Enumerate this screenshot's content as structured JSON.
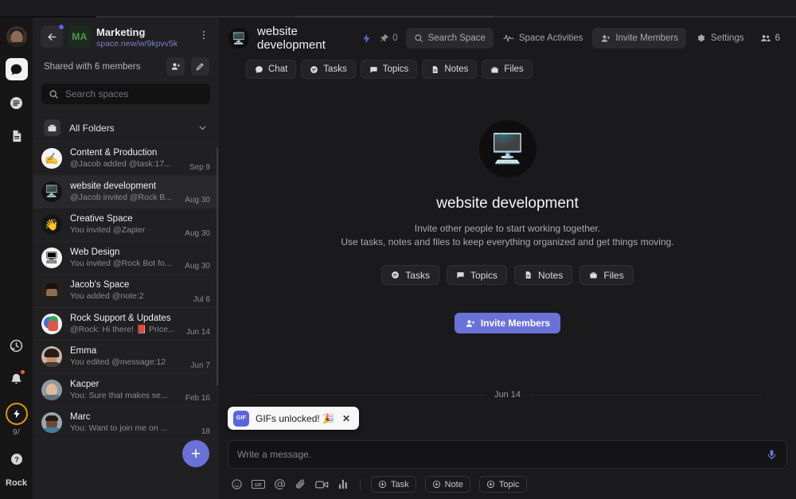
{
  "rail": {
    "avatar_name": "user-avatar",
    "items": [
      {
        "name": "chat",
        "icon": "chat-icon",
        "active": true
      },
      {
        "name": "tasks",
        "icon": "tasks-icon",
        "active": false
      },
      {
        "name": "notes",
        "icon": "notes-icon",
        "active": false
      }
    ],
    "history_icon": "history-clock-icon",
    "notifications_icon": "bell-icon",
    "quick_action_icon": "lightning-bolt-icon",
    "counter": "9/",
    "help_icon": "help-icon",
    "brand": "Rock",
    "accent_orange": "#e8930c"
  },
  "sidebar": {
    "workspace": {
      "badge": "MA",
      "title": "Marketing",
      "url": "space.new/w/9kpvv5k",
      "back_icon": "back-arrow-icon",
      "menu_icon": "kebab-menu-icon"
    },
    "shared_label": "Shared with 6 members",
    "add_member_icon": "add-member-icon",
    "edit_icon": "pencil-edit-icon",
    "search": {
      "placeholder": "Search spaces",
      "value": "",
      "icon": "search-icon"
    },
    "folders": {
      "label": "All Folders",
      "icon": "folder-icon",
      "chevron": "chevron-down-icon"
    },
    "spaces": [
      {
        "name": "Content & Production",
        "preview": "@Jacob added @task:17...",
        "date": "Sep 9",
        "avatar": "writing-hand",
        "selected": false
      },
      {
        "name": "website development",
        "preview": "@Jacob invited @Rock B...",
        "date": "Aug 30",
        "avatar": "desktop",
        "selected": true
      },
      {
        "name": "Creative Space",
        "preview": "You invited @Zapier",
        "date": "Aug 30",
        "avatar": "wave",
        "selected": false
      },
      {
        "name": "Web Design",
        "preview": "You invited @Rock Bot fo...",
        "date": "Aug 30",
        "avatar": "monitor",
        "selected": false
      },
      {
        "name": "Jacob's Space",
        "preview": "You added @note:2",
        "date": "Jul 6",
        "avatar": "person-jacob",
        "selected": false
      },
      {
        "name": "Rock Support & Updates",
        "preview": "@Rock: Hi there! 📕 Price...",
        "date": "Jun 14",
        "avatar": "rock-logo",
        "selected": false
      },
      {
        "name": "Emma",
        "preview": "You edited @message:12",
        "date": "Jun 7",
        "avatar": "person-emma",
        "selected": false
      },
      {
        "name": "Kacper",
        "preview": "You: Sure that makes se...",
        "date": "Feb 16",
        "avatar": "person-kacper",
        "selected": false
      },
      {
        "name": "Marc",
        "preview": "You: Want to join me on ...",
        "date": "18",
        "avatar": "person-marc",
        "selected": false
      }
    ],
    "new_space_label": "+"
  },
  "header": {
    "space_icon": "desktop-icon",
    "title": "website development",
    "bolt_icon": "lightning-bolt-icon",
    "pin_icon": "pin-icon",
    "pin_count": "0",
    "search_space": {
      "label": "Search Space",
      "icon": "search-icon"
    },
    "space_activities": {
      "label": "Space Activities",
      "icon": "activity-icon"
    },
    "invite_members": {
      "label": "Invite Members",
      "icon": "add-member-icon"
    },
    "settings": {
      "label": "Settings",
      "icon": "gear-icon"
    },
    "members_icon": "members-icon",
    "members_count": "6",
    "tabs": [
      {
        "label": "Chat",
        "icon": "chat-bubble-icon"
      },
      {
        "label": "Tasks",
        "icon": "tasks-icon"
      },
      {
        "label": "Topics",
        "icon": "topic-icon"
      },
      {
        "label": "Notes",
        "icon": "note-icon"
      },
      {
        "label": "Files",
        "icon": "folder-icon"
      }
    ]
  },
  "empty_state": {
    "icon": "desktop-icon",
    "title": "website development",
    "line1": "Invite other people to start working together.",
    "line2": "Use tasks, notes and files to keep everything organized and get things moving.",
    "chips": [
      {
        "label": "Tasks",
        "icon": "tasks-icon"
      },
      {
        "label": "Topics",
        "icon": "topic-icon"
      },
      {
        "label": "Notes",
        "icon": "note-icon"
      },
      {
        "label": "Files",
        "icon": "folder-icon"
      }
    ],
    "invite_button": {
      "label": "Invite Members",
      "icon": "add-member-icon",
      "color": "#6a72d8"
    }
  },
  "conversation": {
    "date_divider": "Jun 14"
  },
  "toast": {
    "icon_label": "GIF",
    "text": "GIFs unlocked! 🎉",
    "close": "✕"
  },
  "composer": {
    "placeholder": "Write a message.",
    "value": "",
    "mic_icon": "microphone-icon",
    "tools": [
      {
        "name": "emoji-icon"
      },
      {
        "name": "gif-icon"
      },
      {
        "name": "mention-icon"
      },
      {
        "name": "attachment-icon"
      },
      {
        "name": "video-icon"
      },
      {
        "name": "poll-icon"
      }
    ],
    "actions": [
      {
        "label": "Task",
        "icon": "plus-circle-icon"
      },
      {
        "label": "Note",
        "icon": "plus-circle-icon"
      },
      {
        "label": "Topic",
        "icon": "plus-circle-icon"
      }
    ]
  }
}
